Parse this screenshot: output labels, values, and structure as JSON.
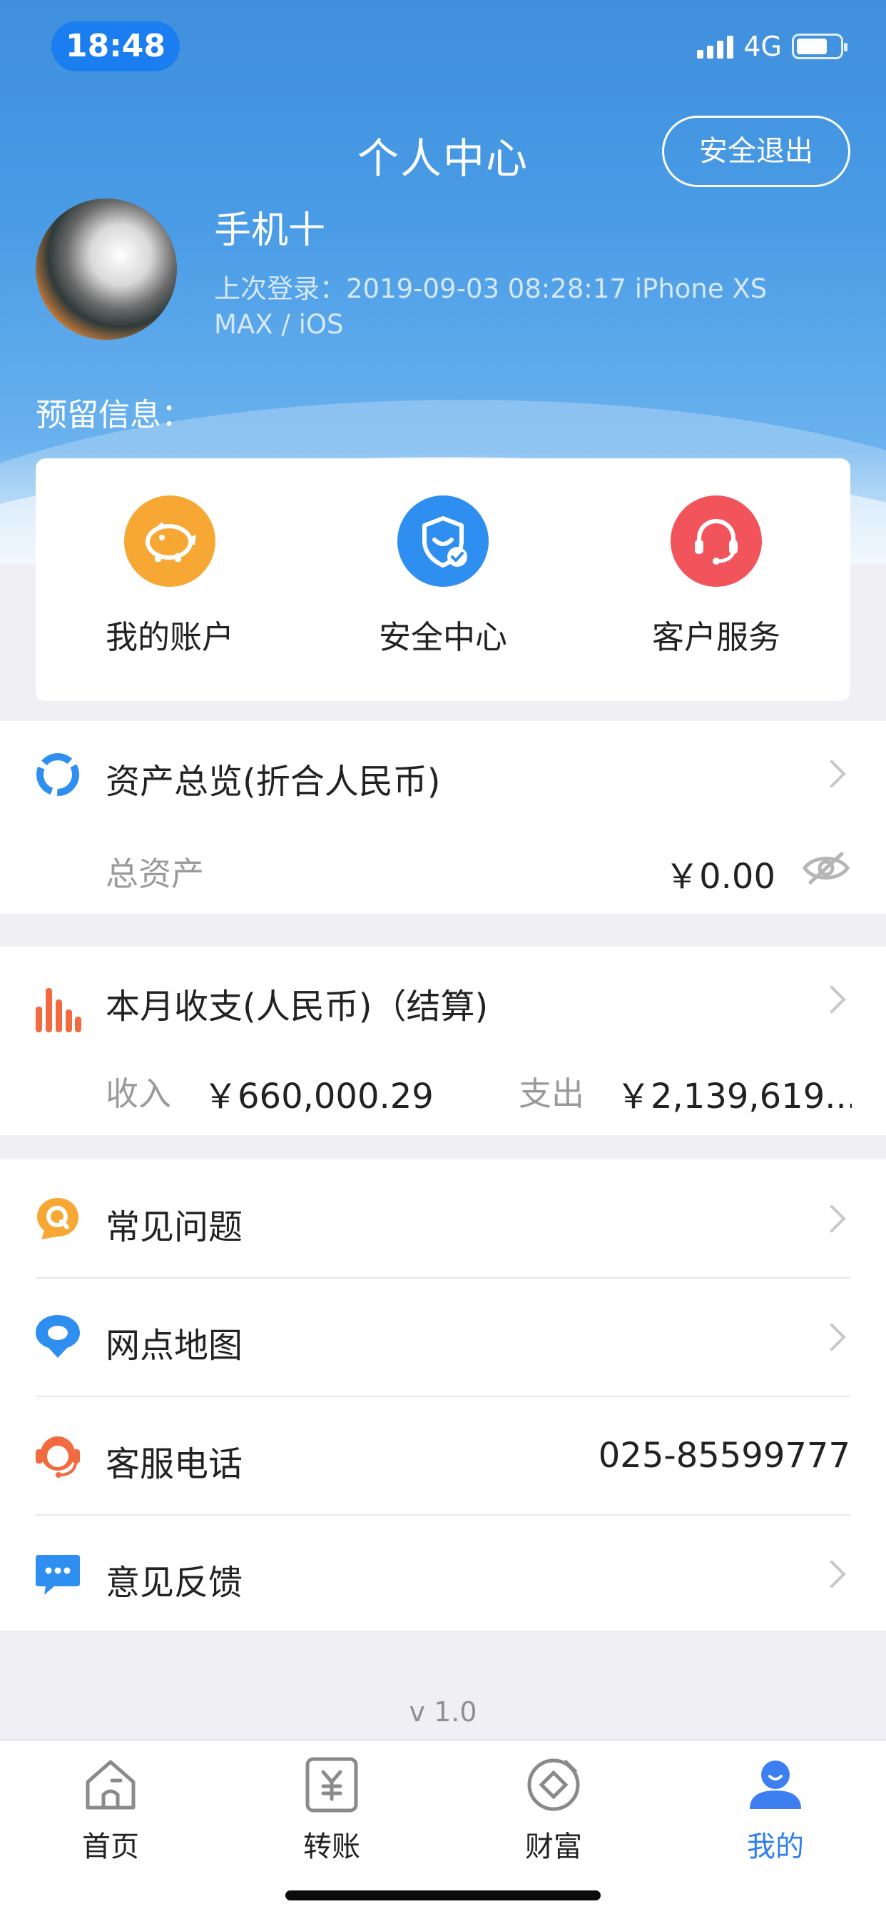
{
  "status_bar": {
    "time": "18:48",
    "network": "4G"
  },
  "header": {
    "title": "个人中心",
    "logout_label": "安全退出",
    "user_name": "手机十",
    "last_login": "上次登录：2019-09-03 08:28:17  iPhone XS MAX / iOS",
    "reserved_info_label": "预留信息："
  },
  "quick_actions": [
    {
      "label": "我的账户",
      "icon": "piggy-bank-icon",
      "color": "#f7a834"
    },
    {
      "label": "安全中心",
      "icon": "shield-check-icon",
      "color": "#2f8ff0"
    },
    {
      "label": "客户服务",
      "icon": "headset-icon",
      "color": "#f2545b"
    }
  ],
  "assets": {
    "title": "资产总览(折合人民币)",
    "total_label": "总资产",
    "total_value": "￥0.00"
  },
  "monthly": {
    "title": "本月收支(人民币)（结算)",
    "income_label": "收入",
    "income_value": "￥660,000.29",
    "expense_label": "支出",
    "expense_value": "￥2,139,619...."
  },
  "menu": [
    {
      "label": "常见问题",
      "icon": "faq-icon",
      "color": "#f7a834"
    },
    {
      "label": "网点地图",
      "icon": "map-pin-icon",
      "color": "#2f8ff0"
    },
    {
      "label": "客服电话",
      "icon": "headset-icon",
      "color": "#f2545b",
      "value": "025-85599777"
    },
    {
      "label": "意见反馈",
      "icon": "chat-bubble-icon",
      "color": "#2f8ff0"
    }
  ],
  "version": "v 1.0",
  "tabs": [
    {
      "label": "首页",
      "icon": "home-icon"
    },
    {
      "label": "转账",
      "icon": "transfer-icon"
    },
    {
      "label": "财富",
      "icon": "wealth-icon"
    },
    {
      "label": "我的",
      "icon": "profile-icon",
      "active": true
    }
  ],
  "colors": {
    "brand_blue": "#2f80ed",
    "orange": "#f7a834",
    "red": "#f2545b"
  }
}
